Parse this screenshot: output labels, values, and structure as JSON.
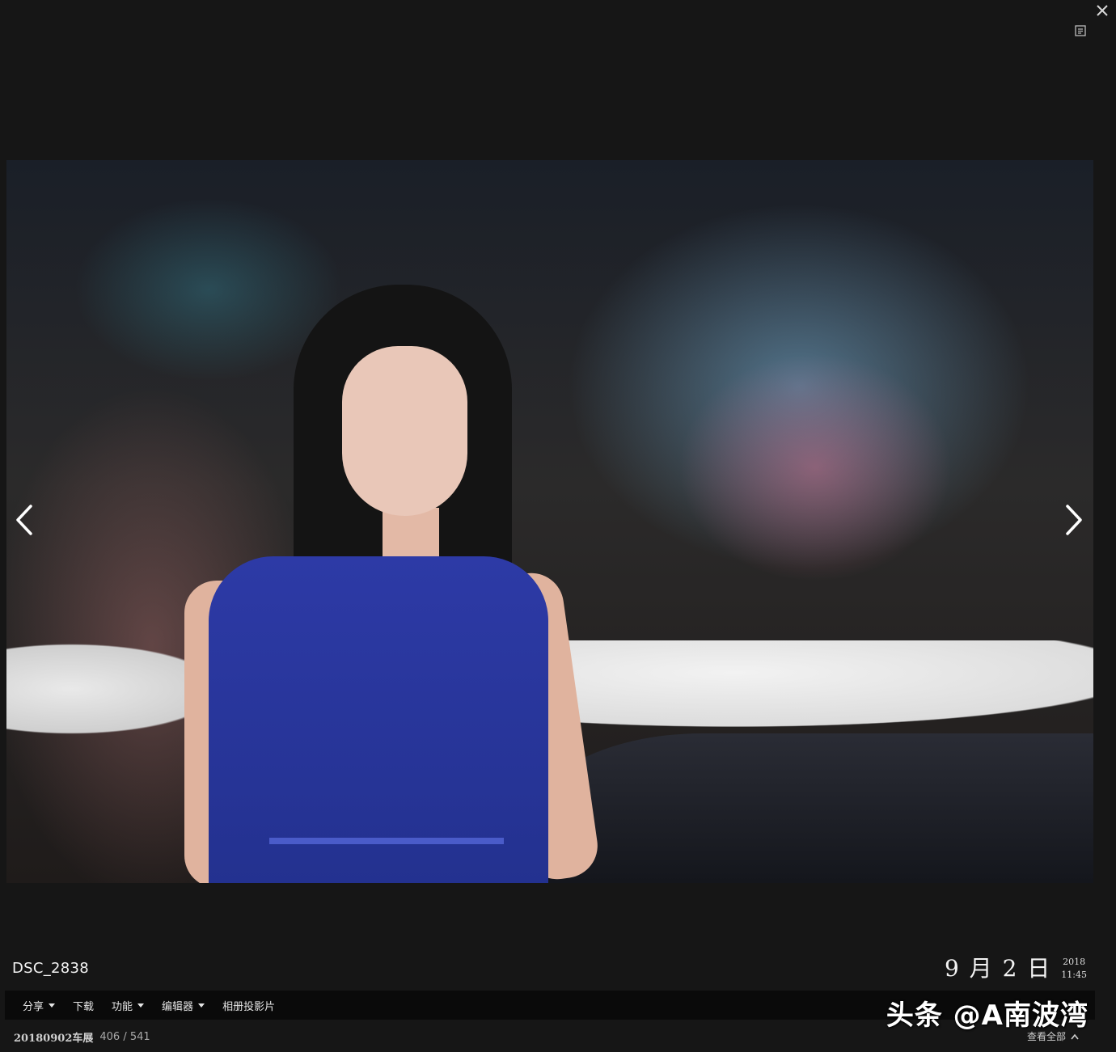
{
  "photo": {
    "name": "DSC_2838"
  },
  "date": {
    "main": "9 月 2 日",
    "year": "2018",
    "time": "11:45"
  },
  "toolbar": {
    "items": [
      {
        "label": "分享",
        "has_dropdown": true
      },
      {
        "label": "下载",
        "has_dropdown": false
      },
      {
        "label": "功能",
        "has_dropdown": true
      },
      {
        "label": "编辑器",
        "has_dropdown": true
      },
      {
        "label": "相册投影片",
        "has_dropdown": false
      }
    ]
  },
  "watermark": "头条 @A南波湾",
  "album": {
    "name": "20180902车展",
    "position": "406 / 541"
  },
  "view_all": "查看全部",
  "icons": {
    "close": "close-icon",
    "info": "info-panel-icon",
    "prev": "chevron-left-icon",
    "next": "chevron-right-icon",
    "expand": "chevron-up-icon"
  }
}
